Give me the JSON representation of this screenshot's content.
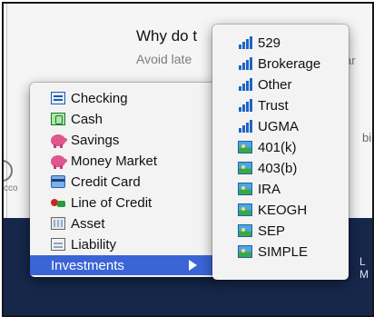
{
  "background": {
    "title": "Why do t",
    "subtitle": "Avoid late",
    "subtitle_right": "ar",
    "side_text": "bi",
    "band_clock": "L M",
    "left_text": "cco"
  },
  "main_menu": {
    "items": [
      {
        "label": "Checking",
        "icon": "checking-icon"
      },
      {
        "label": "Cash",
        "icon": "cash-icon"
      },
      {
        "label": "Savings",
        "icon": "piggy-bank-icon"
      },
      {
        "label": "Money Market",
        "icon": "piggy-bank-icon"
      },
      {
        "label": "Credit Card",
        "icon": "credit-card-icon"
      },
      {
        "label": "Line of Credit",
        "icon": "line-of-credit-icon"
      },
      {
        "label": "Asset",
        "icon": "asset-icon"
      },
      {
        "label": "Liability",
        "icon": "liability-icon"
      },
      {
        "label": "Investments",
        "icon": "submenu-arrow-icon",
        "selected": true
      }
    ]
  },
  "investments_submenu": {
    "items": [
      {
        "label": "529",
        "icon": "bar-chart-icon"
      },
      {
        "label": "Brokerage",
        "icon": "bar-chart-icon"
      },
      {
        "label": "Other",
        "icon": "bar-chart-icon"
      },
      {
        "label": "Trust",
        "icon": "bar-chart-icon"
      },
      {
        "label": "UGMA",
        "icon": "bar-chart-icon"
      },
      {
        "label": "401(k)",
        "icon": "retirement-icon"
      },
      {
        "label": "403(b)",
        "icon": "retirement-icon"
      },
      {
        "label": "IRA",
        "icon": "retirement-icon"
      },
      {
        "label": "KEOGH",
        "icon": "retirement-icon"
      },
      {
        "label": "SEP",
        "icon": "retirement-icon"
      },
      {
        "label": "SIMPLE",
        "icon": "retirement-icon"
      }
    ]
  },
  "colors": {
    "highlight": "#3b64d6",
    "band": "#16274a",
    "menu_bg": "#f3f3f3"
  }
}
